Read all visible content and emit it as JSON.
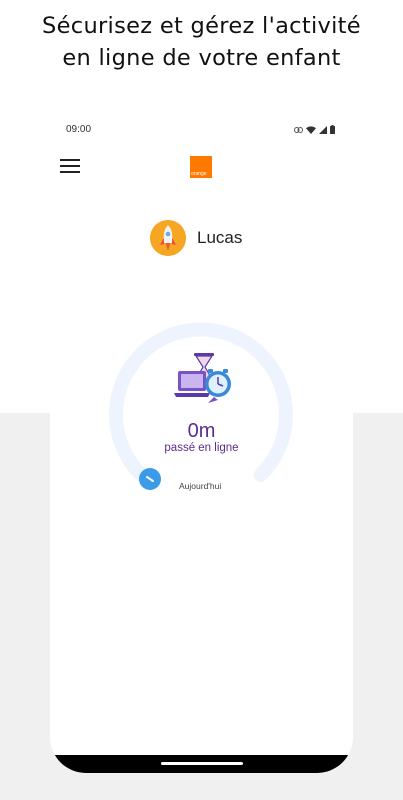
{
  "headline": {
    "line1": "Sécurisez et gérez l'activité",
    "line2": "en ligne de votre enfant"
  },
  "statusbar": {
    "time": "09:00",
    "icons": [
      "link-icon",
      "wifi-icon",
      "signal-icon",
      "battery-icon"
    ]
  },
  "header": {
    "menu_icon": "hamburger-menu-icon",
    "logo_text": "orange",
    "brand_color": "#ff7900"
  },
  "profile": {
    "name": "Lucas",
    "avatar_icon": "rocket-icon"
  },
  "usage": {
    "value": "0m",
    "label": "passé en ligne",
    "period_label": "Aujourd'hui",
    "icon": "screen-time-icon"
  },
  "colors": {
    "accent": "#5b2d8e",
    "gauge_track": "#eef4fd",
    "gauge_knob": "#3c9be8"
  }
}
